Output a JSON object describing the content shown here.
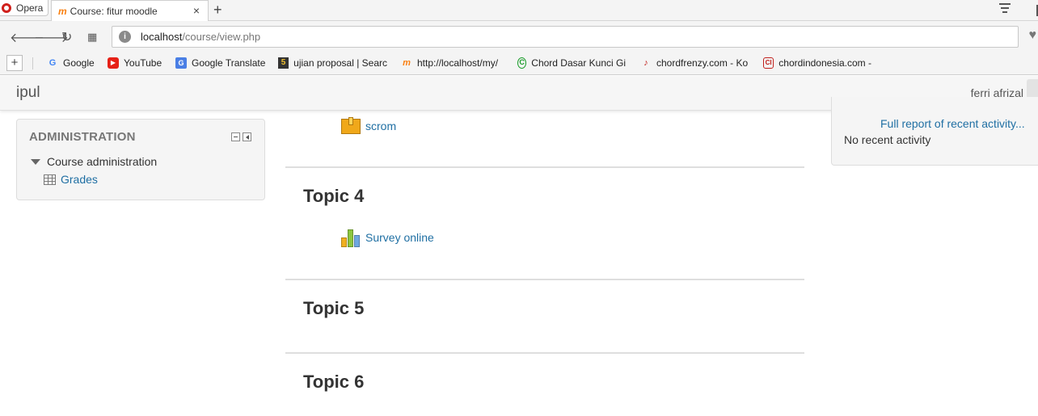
{
  "browser": {
    "opera_label": "Opera",
    "tab_title": "Course: fitur moodle",
    "tab_close": "×",
    "new_tab": "+",
    "url_host": "localhost",
    "url_path": "/course/view.php",
    "nav_icons": [
      "back-icon",
      "forward-icon",
      "reload-icon",
      "speed-dial-icon"
    ],
    "bookmarks": [
      {
        "label": "Google",
        "icon": "google-icon"
      },
      {
        "label": "YouTube",
        "icon": "youtube-icon"
      },
      {
        "label": "Google Translate",
        "icon": "google-translate-icon"
      },
      {
        "label": "ujian proposal | Searc",
        "icon": "bookmark-5-icon"
      },
      {
        "label": "http://localhost/my/",
        "icon": "moodle-icon"
      },
      {
        "label": "Chord Dasar Kunci Gi",
        "icon": "copyright-icon"
      },
      {
        "label": "chordfrenzy.com - Ko",
        "icon": "guitar-icon"
      },
      {
        "label": "chordindonesia.com -",
        "icon": "ci-icon"
      }
    ]
  },
  "moodle": {
    "brand": "ipul",
    "username": "ferri afrizal"
  },
  "admin_block": {
    "title": "ADMINISTRATION",
    "course_admin": "Course administration",
    "grades": "Grades"
  },
  "course": {
    "scorm_activity": "scrom",
    "topics": [
      {
        "title": "Topic 4",
        "activity": "Survey online"
      },
      {
        "title": "Topic 5"
      },
      {
        "title": "Topic 6"
      }
    ]
  },
  "recent_activity": {
    "full_report": "Full report of recent activity...",
    "none_text": "No recent activity"
  },
  "colors": {
    "link": "#1f6fa3",
    "opera_red": "#d0201c",
    "moodle_orange": "#f98012"
  }
}
